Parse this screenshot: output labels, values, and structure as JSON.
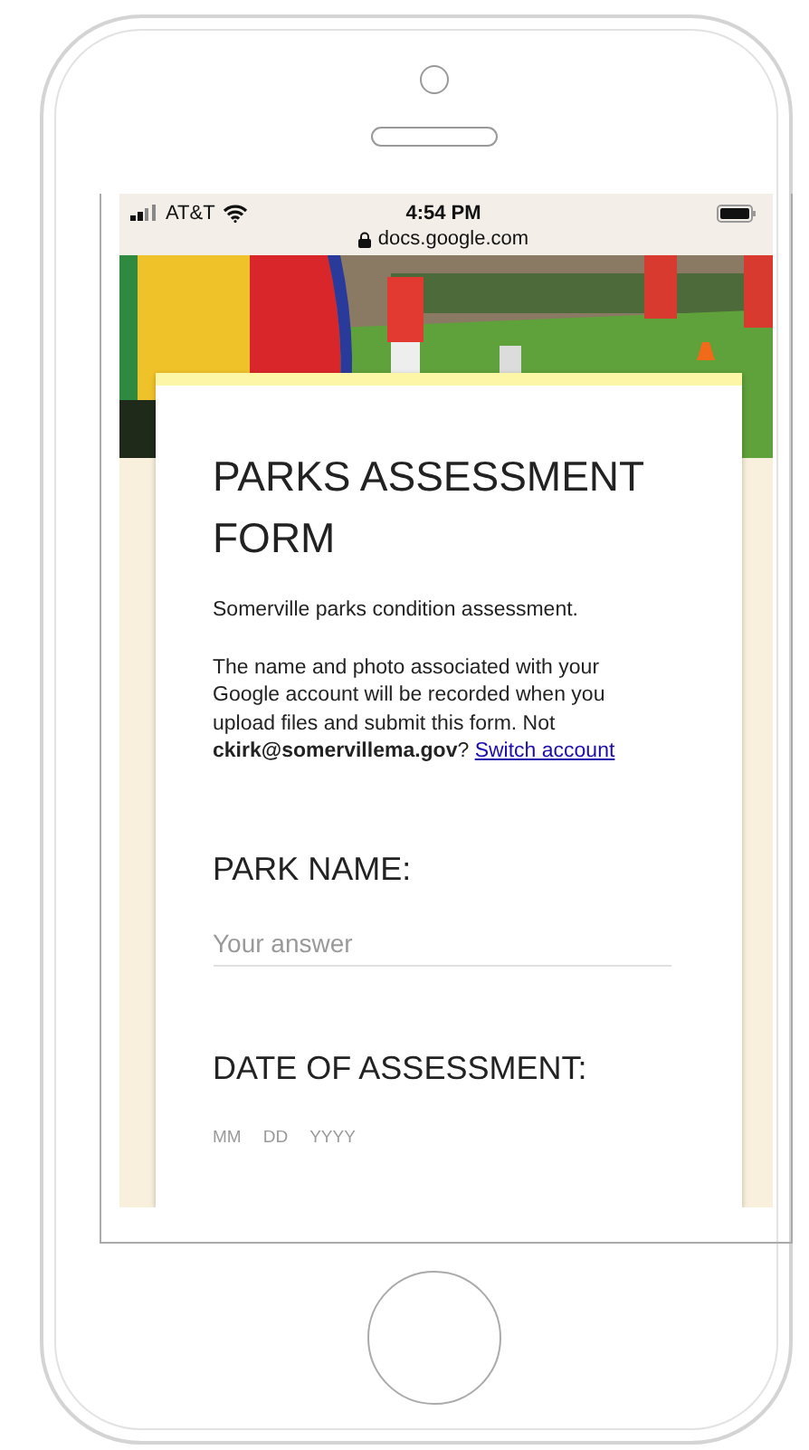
{
  "status_bar": {
    "carrier": "AT&T",
    "time": "4:54 PM",
    "url": "docs.google.com"
  },
  "form": {
    "title": "PARKS ASSESSMENT FORM",
    "description": "Somerville parks condition assessment.",
    "notice": "The name and photo associated with your Google account will be recorded when you upload files and submit this form. Not **ckirk@somervillema.gov**?",
    "switch_link": "Switch account",
    "questions": [
      {
        "kind": "text",
        "label": "PARK NAME:",
        "placeholder": "Your answer"
      },
      {
        "kind": "date",
        "label": "DATE OF ASSESSMENT:",
        "parts": [
          "MM",
          "DD",
          "YYYY"
        ]
      }
    ]
  }
}
